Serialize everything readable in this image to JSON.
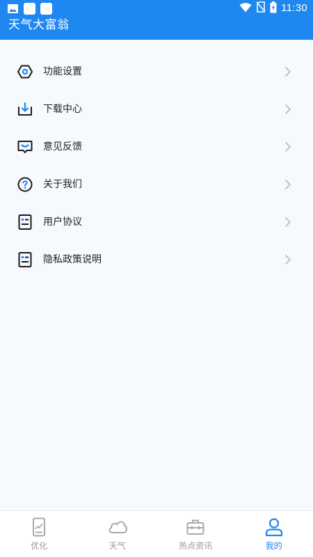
{
  "status_bar": {
    "time": "11:30",
    "icons": [
      "image-notification-icon",
      "square-notification-icon",
      "square-notification-icon",
      "wifi-icon",
      "no-sim-icon",
      "battery-icon"
    ]
  },
  "app_bar": {
    "title": "天气大富翁"
  },
  "menu": {
    "items": [
      {
        "label": "功能设置",
        "icon": "settings-hexagon-icon"
      },
      {
        "label": "下载中心",
        "icon": "download-icon"
      },
      {
        "label": "意见反馈",
        "icon": "feedback-message-icon"
      },
      {
        "label": "关于我们",
        "icon": "help-question-icon"
      },
      {
        "label": "用户协议",
        "icon": "document-icon"
      },
      {
        "label": "隐私政策说明",
        "icon": "document-icon"
      }
    ]
  },
  "bottom_nav": {
    "tabs": [
      {
        "label": "优化",
        "icon": "phone-optimize-icon",
        "active": false
      },
      {
        "label": "天气",
        "icon": "cloud-icon",
        "active": false
      },
      {
        "label": "热点资讯",
        "icon": "briefcase-icon",
        "active": false
      },
      {
        "label": "我的",
        "icon": "user-profile-icon",
        "active": true
      }
    ]
  },
  "colors": {
    "primary": "#1e87f0",
    "background": "#f6f9fd",
    "inactive": "#999999",
    "text": "#222222"
  }
}
